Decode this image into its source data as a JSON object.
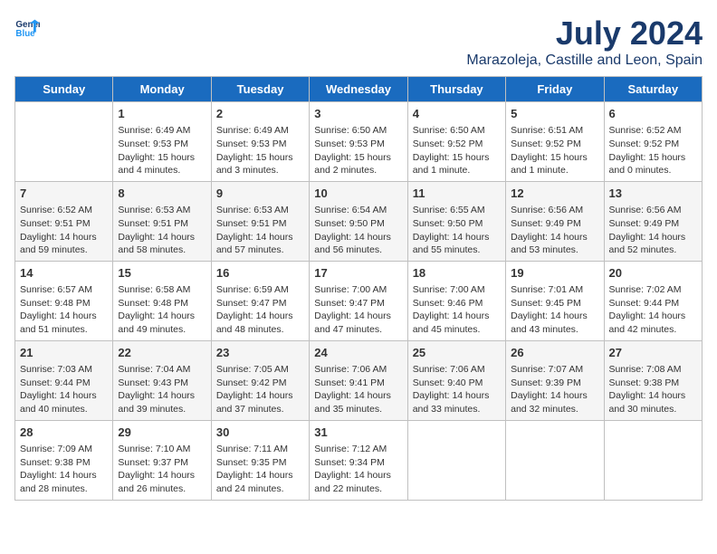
{
  "header": {
    "logo_line1": "General",
    "logo_line2": "Blue",
    "title": "July 2024",
    "subtitle": "Marazoleja, Castille and Leon, Spain"
  },
  "days_of_week": [
    "Sunday",
    "Monday",
    "Tuesday",
    "Wednesday",
    "Thursday",
    "Friday",
    "Saturday"
  ],
  "weeks": [
    [
      {
        "day": "",
        "sunrise": "",
        "sunset": "",
        "daylight": ""
      },
      {
        "day": "1",
        "sunrise": "Sunrise: 6:49 AM",
        "sunset": "Sunset: 9:53 PM",
        "daylight": "Daylight: 15 hours and 4 minutes."
      },
      {
        "day": "2",
        "sunrise": "Sunrise: 6:49 AM",
        "sunset": "Sunset: 9:53 PM",
        "daylight": "Daylight: 15 hours and 3 minutes."
      },
      {
        "day": "3",
        "sunrise": "Sunrise: 6:50 AM",
        "sunset": "Sunset: 9:53 PM",
        "daylight": "Daylight: 15 hours and 2 minutes."
      },
      {
        "day": "4",
        "sunrise": "Sunrise: 6:50 AM",
        "sunset": "Sunset: 9:52 PM",
        "daylight": "Daylight: 15 hours and 1 minute."
      },
      {
        "day": "5",
        "sunrise": "Sunrise: 6:51 AM",
        "sunset": "Sunset: 9:52 PM",
        "daylight": "Daylight: 15 hours and 1 minute."
      },
      {
        "day": "6",
        "sunrise": "Sunrise: 6:52 AM",
        "sunset": "Sunset: 9:52 PM",
        "daylight": "Daylight: 15 hours and 0 minutes."
      }
    ],
    [
      {
        "day": "7",
        "sunrise": "Sunrise: 6:52 AM",
        "sunset": "Sunset: 9:51 PM",
        "daylight": "Daylight: 14 hours and 59 minutes."
      },
      {
        "day": "8",
        "sunrise": "Sunrise: 6:53 AM",
        "sunset": "Sunset: 9:51 PM",
        "daylight": "Daylight: 14 hours and 58 minutes."
      },
      {
        "day": "9",
        "sunrise": "Sunrise: 6:53 AM",
        "sunset": "Sunset: 9:51 PM",
        "daylight": "Daylight: 14 hours and 57 minutes."
      },
      {
        "day": "10",
        "sunrise": "Sunrise: 6:54 AM",
        "sunset": "Sunset: 9:50 PM",
        "daylight": "Daylight: 14 hours and 56 minutes."
      },
      {
        "day": "11",
        "sunrise": "Sunrise: 6:55 AM",
        "sunset": "Sunset: 9:50 PM",
        "daylight": "Daylight: 14 hours and 55 minutes."
      },
      {
        "day": "12",
        "sunrise": "Sunrise: 6:56 AM",
        "sunset": "Sunset: 9:49 PM",
        "daylight": "Daylight: 14 hours and 53 minutes."
      },
      {
        "day": "13",
        "sunrise": "Sunrise: 6:56 AM",
        "sunset": "Sunset: 9:49 PM",
        "daylight": "Daylight: 14 hours and 52 minutes."
      }
    ],
    [
      {
        "day": "14",
        "sunrise": "Sunrise: 6:57 AM",
        "sunset": "Sunset: 9:48 PM",
        "daylight": "Daylight: 14 hours and 51 minutes."
      },
      {
        "day": "15",
        "sunrise": "Sunrise: 6:58 AM",
        "sunset": "Sunset: 9:48 PM",
        "daylight": "Daylight: 14 hours and 49 minutes."
      },
      {
        "day": "16",
        "sunrise": "Sunrise: 6:59 AM",
        "sunset": "Sunset: 9:47 PM",
        "daylight": "Daylight: 14 hours and 48 minutes."
      },
      {
        "day": "17",
        "sunrise": "Sunrise: 7:00 AM",
        "sunset": "Sunset: 9:47 PM",
        "daylight": "Daylight: 14 hours and 47 minutes."
      },
      {
        "day": "18",
        "sunrise": "Sunrise: 7:00 AM",
        "sunset": "Sunset: 9:46 PM",
        "daylight": "Daylight: 14 hours and 45 minutes."
      },
      {
        "day": "19",
        "sunrise": "Sunrise: 7:01 AM",
        "sunset": "Sunset: 9:45 PM",
        "daylight": "Daylight: 14 hours and 43 minutes."
      },
      {
        "day": "20",
        "sunrise": "Sunrise: 7:02 AM",
        "sunset": "Sunset: 9:44 PM",
        "daylight": "Daylight: 14 hours and 42 minutes."
      }
    ],
    [
      {
        "day": "21",
        "sunrise": "Sunrise: 7:03 AM",
        "sunset": "Sunset: 9:44 PM",
        "daylight": "Daylight: 14 hours and 40 minutes."
      },
      {
        "day": "22",
        "sunrise": "Sunrise: 7:04 AM",
        "sunset": "Sunset: 9:43 PM",
        "daylight": "Daylight: 14 hours and 39 minutes."
      },
      {
        "day": "23",
        "sunrise": "Sunrise: 7:05 AM",
        "sunset": "Sunset: 9:42 PM",
        "daylight": "Daylight: 14 hours and 37 minutes."
      },
      {
        "day": "24",
        "sunrise": "Sunrise: 7:06 AM",
        "sunset": "Sunset: 9:41 PM",
        "daylight": "Daylight: 14 hours and 35 minutes."
      },
      {
        "day": "25",
        "sunrise": "Sunrise: 7:06 AM",
        "sunset": "Sunset: 9:40 PM",
        "daylight": "Daylight: 14 hours and 33 minutes."
      },
      {
        "day": "26",
        "sunrise": "Sunrise: 7:07 AM",
        "sunset": "Sunset: 9:39 PM",
        "daylight": "Daylight: 14 hours and 32 minutes."
      },
      {
        "day": "27",
        "sunrise": "Sunrise: 7:08 AM",
        "sunset": "Sunset: 9:38 PM",
        "daylight": "Daylight: 14 hours and 30 minutes."
      }
    ],
    [
      {
        "day": "28",
        "sunrise": "Sunrise: 7:09 AM",
        "sunset": "Sunset: 9:38 PM",
        "daylight": "Daylight: 14 hours and 28 minutes."
      },
      {
        "day": "29",
        "sunrise": "Sunrise: 7:10 AM",
        "sunset": "Sunset: 9:37 PM",
        "daylight": "Daylight: 14 hours and 26 minutes."
      },
      {
        "day": "30",
        "sunrise": "Sunrise: 7:11 AM",
        "sunset": "Sunset: 9:35 PM",
        "daylight": "Daylight: 14 hours and 24 minutes."
      },
      {
        "day": "31",
        "sunrise": "Sunrise: 7:12 AM",
        "sunset": "Sunset: 9:34 PM",
        "daylight": "Daylight: 14 hours and 22 minutes."
      },
      {
        "day": "",
        "sunrise": "",
        "sunset": "",
        "daylight": ""
      },
      {
        "day": "",
        "sunrise": "",
        "sunset": "",
        "daylight": ""
      },
      {
        "day": "",
        "sunrise": "",
        "sunset": "",
        "daylight": ""
      }
    ]
  ]
}
